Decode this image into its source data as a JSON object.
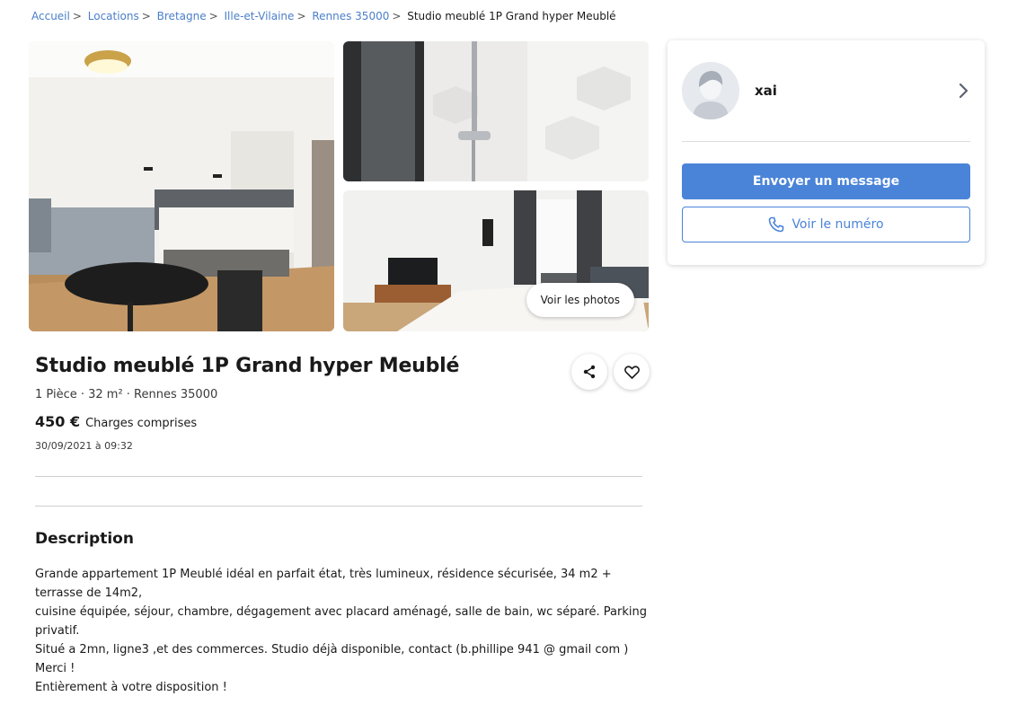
{
  "breadcrumb": {
    "links": [
      "Accueil",
      "Locations",
      "Bretagne",
      "Ille-et-Vilaine",
      "Rennes 35000"
    ],
    "separator": ">",
    "current": "Studio meublé 1P Grand hyper Meublé"
  },
  "gallery": {
    "see_photos_label": "Voir les photos"
  },
  "ad": {
    "title": "Studio meublé 1P Grand hyper Meublé",
    "meta": "1 Pièce · 32 m² · Rennes 35000",
    "price": "450 €",
    "price_note": "Charges comprises",
    "date": "30/09/2021 à 09:32"
  },
  "description": {
    "heading": "Description",
    "lines": [
      "Grande appartement 1P Meublé idéal en parfait état, très lumineux, résidence sécurisée, 34 m2 +",
      "terrasse de 14m2,",
      "cuisine équipée, séjour, chambre, dégagement avec placard aménagé, salle de bain, wc séparé. Parking",
      "privatif.",
      "Situé a 2mn, ligne3 ,et des commerces. Studio déjà disponible, contact (b.phillipe 941 @ gmail com )",
      "Merci !",
      "Entièrement à votre disposition !"
    ]
  },
  "seller": {
    "name": "xai",
    "message_button": "Envoyer un message",
    "phone_button": "Voir le numéro"
  },
  "icons": {
    "share": "share-icon",
    "favorite": "heart-icon",
    "phone": "phone-icon",
    "chevron": "chevron-right-icon"
  },
  "colors": {
    "accent": "#4a84d8",
    "link": "#4a7fc9"
  }
}
